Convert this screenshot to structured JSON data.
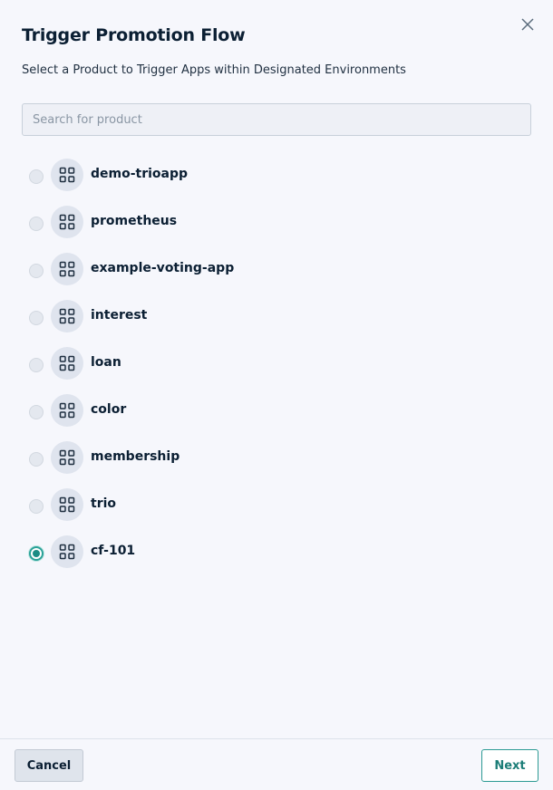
{
  "dialog": {
    "title": "Trigger Promotion Flow",
    "subtitle": "Select a Product to Trigger Apps within Designated Environments",
    "close_icon": "close-icon"
  },
  "search": {
    "placeholder": "Search for product",
    "value": ""
  },
  "products": [
    {
      "label": "demo-trioapp",
      "icon": "product-grid-icon",
      "selected": false
    },
    {
      "label": "prometheus",
      "icon": "product-grid-icon",
      "selected": false
    },
    {
      "label": "example-voting-app",
      "icon": "product-grid-icon",
      "selected": false
    },
    {
      "label": "interest",
      "icon": "product-grid-icon",
      "selected": false
    },
    {
      "label": "loan",
      "icon": "product-grid-icon",
      "selected": false
    },
    {
      "label": "color",
      "icon": "product-grid-icon",
      "selected": false
    },
    {
      "label": "membership",
      "icon": "product-grid-icon",
      "selected": false
    },
    {
      "label": "trio",
      "icon": "product-grid-icon",
      "selected": false
    },
    {
      "label": "cf-101",
      "icon": "product-grid-icon",
      "selected": true
    }
  ],
  "footer": {
    "cancel_label": "Cancel",
    "next_label": "Next"
  },
  "colors": {
    "accent": "#2aa198",
    "background": "#f6f7fc",
    "text": "#0b1f33"
  }
}
